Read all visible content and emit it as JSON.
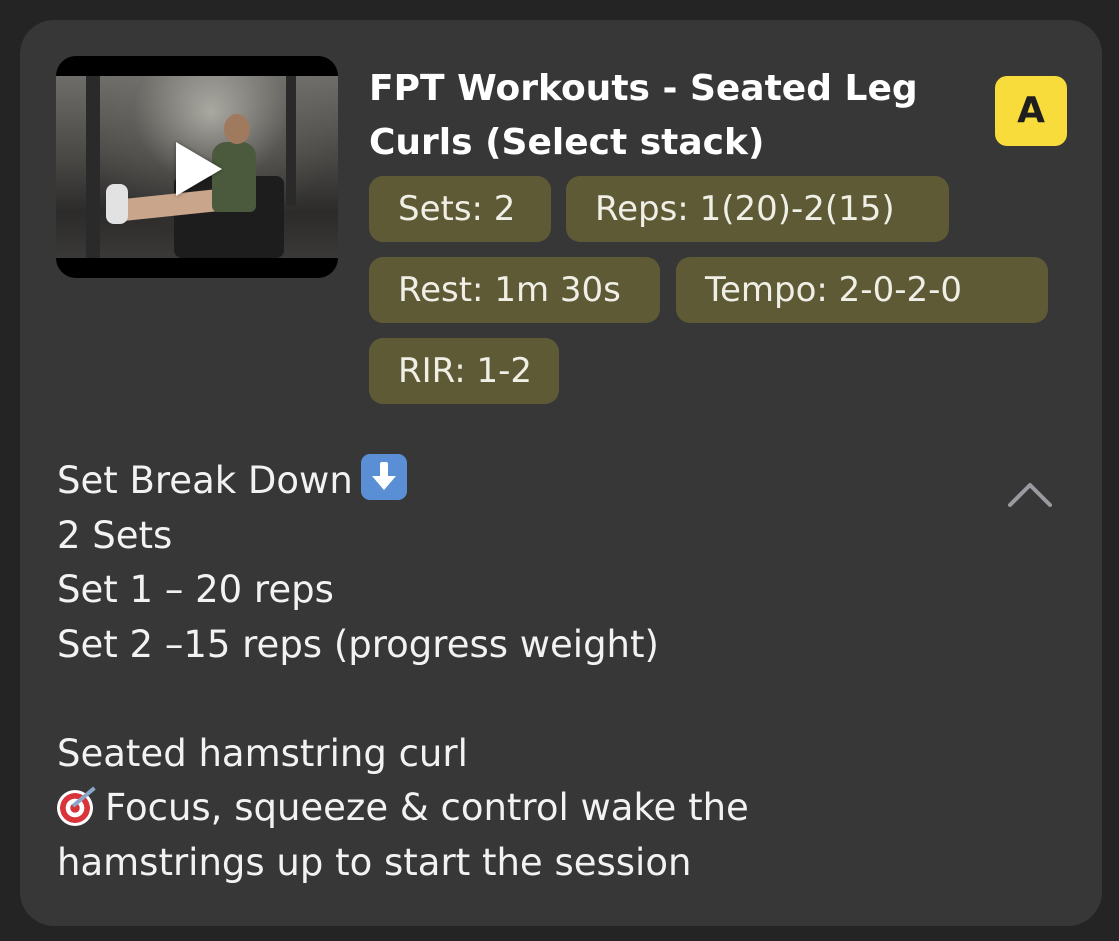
{
  "exercise": {
    "title": "FPT Workouts - Seated Leg Curls (Select stack)",
    "badge": "A",
    "video": {
      "play_icon": "play-icon"
    },
    "chips": {
      "sets": "Sets: 2",
      "reps": "Reps: 1(20)-2(15)",
      "rest": "Rest: 1m 30s",
      "tempo": "Tempo: 2-0-2-0",
      "rir": "RIR: 1-2"
    },
    "description": {
      "line1": "Set Break Down",
      "line1_icon": "down-arrow-emoji",
      "line2": "2 Sets",
      "line3": "Set 1 – 20 reps",
      "line4": "Set 2 –15 reps (progress weight)",
      "line5": "Seated hamstring curl",
      "line6_icon": "target-emoji",
      "line6": "Focus, squeeze & control wake the",
      "line7": "hamstrings up to start the session"
    },
    "collapse_icon": "chevron-up-icon"
  },
  "colors": {
    "background": "#242424",
    "card": "#373737",
    "chip": "#5f5a36",
    "badge": "#f7dc3b"
  }
}
